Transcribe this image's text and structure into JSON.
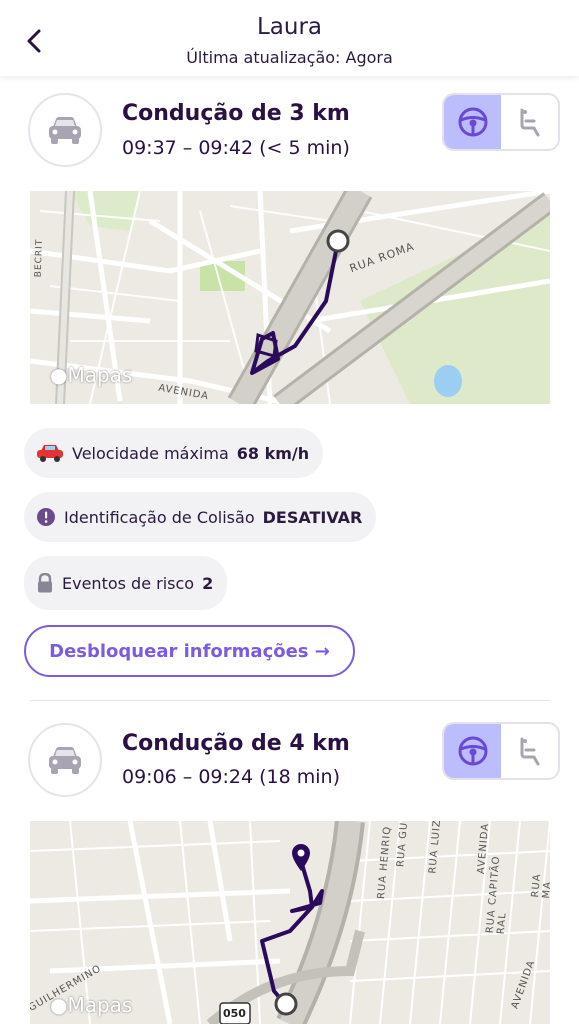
{
  "header": {
    "title": "Laura",
    "subtitle": "Última atualização: Agora"
  },
  "trips": [
    {
      "title": "Condução de 3 km",
      "time": "09:37 – 09:42 (< 5 min)",
      "map": {
        "logo": "Mapas",
        "street_labels": [
          "RUA ROMA",
          "AVENIDA",
          "BECRIT"
        ]
      }
    },
    {
      "title": "Condução de 4 km",
      "time": "09:06 – 09:24 (18 min)",
      "map": {
        "logo": "Mapas",
        "street_labels": [
          "RUA HENRIQ",
          "RUA GU",
          "RUA LUIZ",
          "AVENIDA",
          "RUA CAPITÃO RAL",
          "RUA MA",
          "GUILHERMINO",
          "AVENIDA",
          "050"
        ]
      }
    }
  ],
  "stats": {
    "speed_label": "Velocidade máxima",
    "speed_value": "68 km/h",
    "collision_label": "Identificação de Colisão",
    "collision_value": "DESATIVAR",
    "risk_label": "Eventos de risco",
    "risk_value": "2"
  },
  "unlock_button": "Desbloquear informações →",
  "colors": {
    "accent": "#7d5be0",
    "route": "#2b0a5c",
    "toggle_active": "#bcbdfc",
    "chip_bg": "#f2f1f4"
  },
  "icons": [
    "back-chevron-icon",
    "car-icon",
    "steering-wheel-icon",
    "passenger-seat-icon",
    "red-car-emoji-icon",
    "warning-icon",
    "lock-icon",
    "apple-icon",
    "map-pin-icon"
  ]
}
